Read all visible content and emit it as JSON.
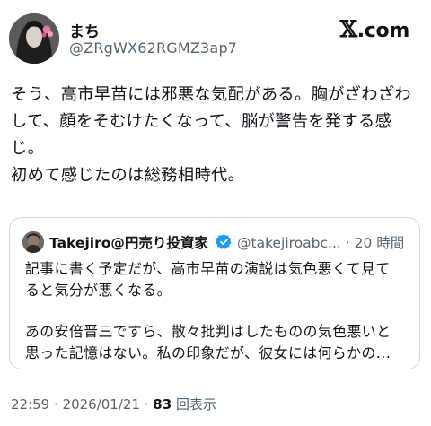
{
  "author": {
    "display_name": "まち",
    "handle": "@ZRgWX62RGMZ3ap7"
  },
  "brand": {
    "x_mark": "𝕏",
    "suffix": ".com"
  },
  "post": {
    "lines": [
      "そう、高市早苗には邪悪な気配がある。胸がざわざわ",
      "して、顔をそむけたくなって、脳が警告を発する感",
      "じ。",
      "初めて感じたのは総務相時代。"
    ]
  },
  "quoted_post": {
    "display_name": "Takejiro@円売り投資家",
    "meta": "@takejiroabc... · 20 時間",
    "lines": [
      "記事に書く予定だが、高市早苗の演説は気色悪くて見て",
      "ると気分が悪くなる。",
      "",
      "あの安倍晋三ですら、散々批判はしたものの気色悪いと",
      "思った記憶はない。私の印象だが、彼女には何らかの..."
    ]
  },
  "footer": {
    "timestamp": "22:59 · 2026/01/21 · ",
    "views_count": "83",
    "views_label": " 回表示"
  },
  "colors": {
    "text": "#0f1419",
    "secondary": "#536471",
    "border": "#cfd9de",
    "verified": "#1d9bf0"
  }
}
